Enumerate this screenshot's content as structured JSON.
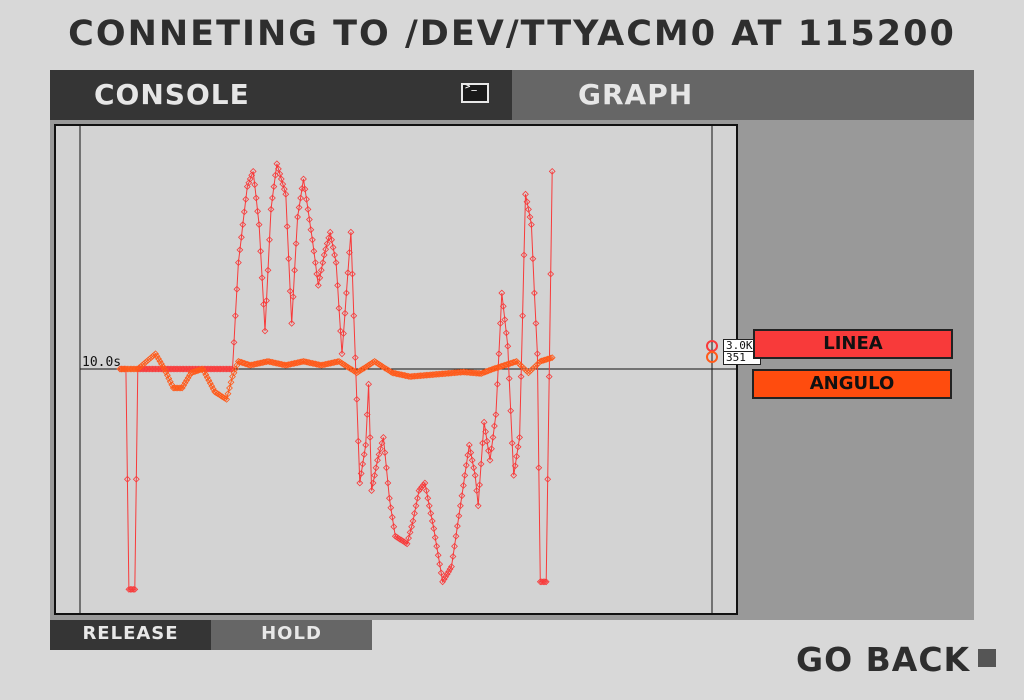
{
  "header": {
    "title": "CONNETING TO /DEV/TTYACM0 AT 115200"
  },
  "tabs": [
    {
      "label": "CONSOLE",
      "icon": "terminal-icon",
      "terminal_prompt": ">_"
    },
    {
      "label": "GRAPH",
      "icon": "signal-bars-icon"
    }
  ],
  "colors": {
    "linea": "#f83a3a",
    "angulo": "#ff5a1a",
    "dark_tab": "#353535",
    "light_tab": "#666666",
    "panel": "#999999",
    "plot_bg": "#d3d3d3"
  },
  "plot": {
    "time_label": "10.0s"
  },
  "chart_data": {
    "type": "line",
    "x_unit": "s",
    "xlim": [
      0,
      10
    ],
    "ylim": [
      -3000,
      3000
    ],
    "series": [
      {
        "name": "LINEA",
        "current_value": "3.0K",
        "points": [
          [
            0.0,
            0
          ],
          [
            0.1,
            0
          ],
          [
            0.15,
            -2900
          ],
          [
            0.25,
            -2900
          ],
          [
            0.3,
            0
          ],
          [
            1.9,
            0
          ],
          [
            2.0,
            1400
          ],
          [
            2.15,
            2400
          ],
          [
            2.25,
            2600
          ],
          [
            2.35,
            1900
          ],
          [
            2.45,
            500
          ],
          [
            2.55,
            2100
          ],
          [
            2.65,
            2700
          ],
          [
            2.8,
            2300
          ],
          [
            2.9,
            600
          ],
          [
            3.0,
            2000
          ],
          [
            3.1,
            2500
          ],
          [
            3.25,
            1700
          ],
          [
            3.35,
            1100
          ],
          [
            3.45,
            1500
          ],
          [
            3.55,
            1800
          ],
          [
            3.65,
            1400
          ],
          [
            3.75,
            200
          ],
          [
            3.9,
            1800
          ],
          [
            4.05,
            -1500
          ],
          [
            4.15,
            -1000
          ],
          [
            4.2,
            -200
          ],
          [
            4.25,
            -1600
          ],
          [
            4.35,
            -1200
          ],
          [
            4.45,
            -900
          ],
          [
            4.55,
            -1700
          ],
          [
            4.65,
            -2200
          ],
          [
            4.85,
            -2300
          ],
          [
            4.95,
            -2000
          ],
          [
            5.05,
            -1600
          ],
          [
            5.15,
            -1500
          ],
          [
            5.3,
            -2100
          ],
          [
            5.45,
            -2800
          ],
          [
            5.6,
            -2600
          ],
          [
            5.75,
            -1800
          ],
          [
            5.9,
            -1000
          ],
          [
            6.0,
            -1400
          ],
          [
            6.05,
            -1800
          ],
          [
            6.15,
            -700
          ],
          [
            6.25,
            -1200
          ],
          [
            6.35,
            -600
          ],
          [
            6.45,
            1000
          ],
          [
            6.55,
            300
          ],
          [
            6.65,
            -1400
          ],
          [
            6.75,
            -900
          ],
          [
            6.85,
            2300
          ],
          [
            6.95,
            1900
          ],
          [
            7.0,
            1000
          ],
          [
            7.05,
            200
          ],
          [
            7.1,
            -2800
          ],
          [
            7.2,
            -2800
          ],
          [
            7.3,
            2600
          ]
        ]
      },
      {
        "name": "ANGULO",
        "current_value": "351",
        "points": [
          [
            0.0,
            0
          ],
          [
            0.3,
            0
          ],
          [
            0.45,
            100
          ],
          [
            0.6,
            200
          ],
          [
            0.75,
            0
          ],
          [
            0.9,
            -250
          ],
          [
            1.05,
            -250
          ],
          [
            1.2,
            -50
          ],
          [
            1.4,
            0
          ],
          [
            1.6,
            -300
          ],
          [
            1.8,
            -400
          ],
          [
            1.9,
            -100
          ],
          [
            2.0,
            100
          ],
          [
            2.2,
            50
          ],
          [
            2.5,
            100
          ],
          [
            2.8,
            50
          ],
          [
            3.1,
            100
          ],
          [
            3.4,
            50
          ],
          [
            3.7,
            100
          ],
          [
            4.0,
            -50
          ],
          [
            4.3,
            100
          ],
          [
            4.6,
            -50
          ],
          [
            4.9,
            -100
          ],
          [
            5.2,
            -80
          ],
          [
            5.5,
            -60
          ],
          [
            5.8,
            -40
          ],
          [
            6.1,
            -60
          ],
          [
            6.3,
            0
          ],
          [
            6.5,
            50
          ],
          [
            6.7,
            100
          ],
          [
            6.9,
            -50
          ],
          [
            7.1,
            100
          ],
          [
            7.3,
            150
          ]
        ]
      }
    ]
  },
  "buttons": {
    "release": "RELEASE",
    "hold": "HOLD",
    "go_back": "GO BACK"
  }
}
